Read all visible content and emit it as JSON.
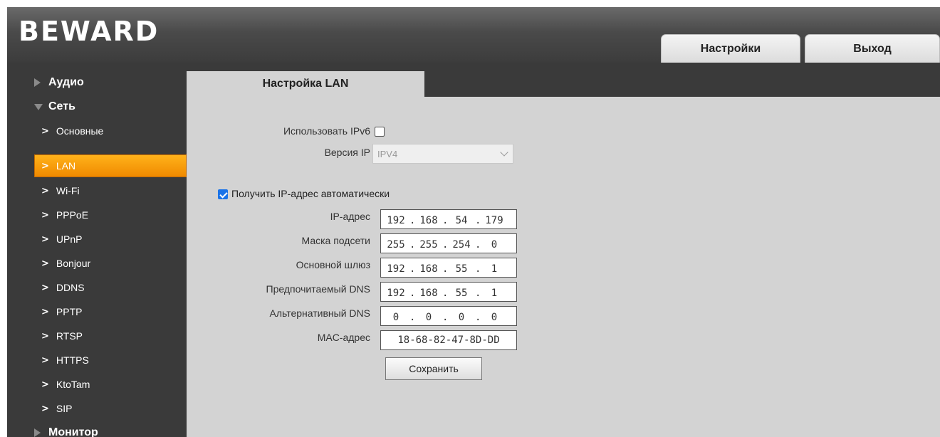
{
  "header": {
    "logo_text": "BEWARD",
    "tabs": [
      {
        "label": "Настройки"
      },
      {
        "label": "Выход"
      }
    ]
  },
  "sidebar": {
    "sections": [
      {
        "label": "Аудио",
        "expanded": false
      },
      {
        "label": "Сеть",
        "expanded": true
      },
      {
        "label": "Монитор",
        "expanded": false
      }
    ],
    "items": [
      {
        "label": "Основные"
      },
      {
        "label": "LAN",
        "active": true
      },
      {
        "label": "Wi-Fi"
      },
      {
        "label": "PPPoE"
      },
      {
        "label": "UPnP"
      },
      {
        "label": "Bonjour"
      },
      {
        "label": "DDNS"
      },
      {
        "label": "PPTP"
      },
      {
        "label": "RTSP"
      },
      {
        "label": "HTTPS"
      },
      {
        "label": "KtoTam"
      },
      {
        "label": "SIP"
      }
    ],
    "chevron": ">"
  },
  "content": {
    "tab_title": "Настройка LAN",
    "use_ipv6": {
      "label": "Использовать IPv6",
      "checked": false
    },
    "ip_version": {
      "label": "Версия IP",
      "value": "IPV4"
    },
    "auto_ip": {
      "label": "Получить IP-адрес автоматически",
      "checked": true
    },
    "fields": {
      "ip_address": {
        "label": "IP-адрес",
        "octets": [
          "192",
          "168",
          "54",
          "179"
        ]
      },
      "subnet_mask": {
        "label": "Маска подсети",
        "octets": [
          "255",
          "255",
          "254",
          "0"
        ]
      },
      "gateway": {
        "label": "Основной шлюз",
        "octets": [
          "192",
          "168",
          "55",
          "1"
        ]
      },
      "preferred_dns": {
        "label": "Предпочитаемый DNS",
        "octets": [
          "192",
          "168",
          "55",
          "1"
        ]
      },
      "alternate_dns": {
        "label": "Альтернативный DNS",
        "octets": [
          "0",
          "0",
          "0",
          "0"
        ]
      }
    },
    "separator": ".",
    "mac": {
      "label": "MAC-адрес",
      "value": "18-68-82-47-8D-DD"
    },
    "save_label": "Сохранить"
  },
  "colors": {
    "active_item": "#f59a10",
    "background_dark": "#3a3a3a",
    "panel": "#d3d3d3",
    "checkbox_checked": "#1a73e8"
  }
}
